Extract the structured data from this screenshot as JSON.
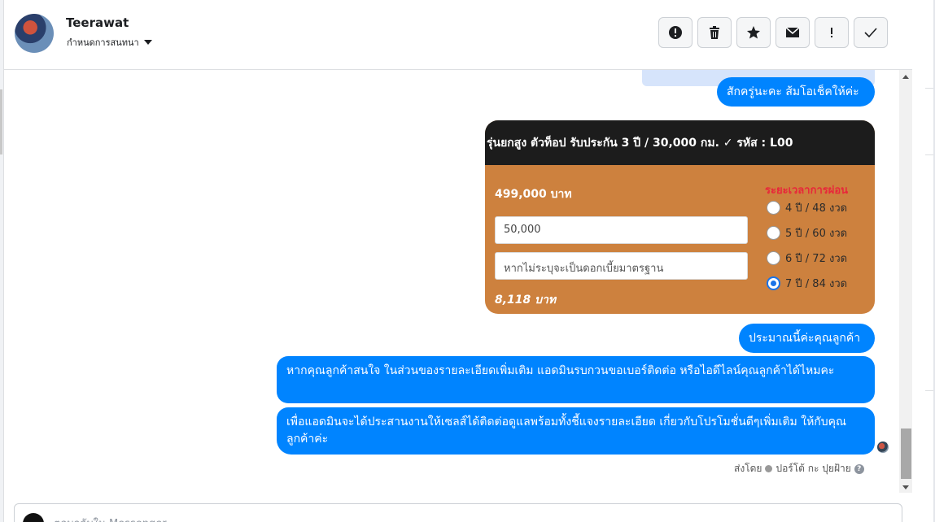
{
  "header": {
    "contact_name": "Teerawat",
    "assign_label": "กำหนดการสนทนา",
    "toolbar": [
      "spam-icon",
      "trash-icon",
      "star-icon",
      "envelope-icon",
      "exclamation-icon",
      "check-icon"
    ]
  },
  "messages": {
    "m1": "สักครู่นะคะ ส้มโอเช็คให้ค่ะ",
    "m2": "ประมาณนี้ค่ะคุณลูกค้า",
    "m3": "หากคุณลูกค้าสนใจ ในส่วนของรายละเอียดเพิ่มเติม แอดมินรบกวนขอเบอร์ติดต่อ หรือไอดีไลน์คุณลูกค้าได้ไหมคะ",
    "m4": "เพื่อแอดมินจะได้ประสานงานให้เซลส์ได้ติดต่อดูแลพร้อมทั้งชี้แจงรายละเอียด เกี่ยวกับโปรโมชั่นดีๆเพิ่มเติม ให้กับคุณลูกค้าค่ะ"
  },
  "card": {
    "headline": "รุ่นยกสูง ตัวท็อป รับประกัน 3 ปี / 30,000 กม. ✓ รหัส : L00",
    "price": "499,000 บาท",
    "down_payment": "50,000",
    "interest_placeholder": "หากไม่ระบุจะเป็นดอกเบี้ยมาตรฐาน",
    "monthly": "8,118 บาท",
    "plan_title": "ระยะเวลาการผ่อน",
    "options": [
      "4 ปี / 48 งวด",
      "5 ปี / 60 งวด",
      "6 ปี / 72 งวด",
      "7 ปี / 84 งวด"
    ],
    "selected_option": "7 ปี / 84 งวด"
  },
  "footer": {
    "sent_by_label": "ส่งโดย",
    "sent_by_name": "ปอร์โต้ กะ ปุยฝ้าย",
    "composer_placeholder": "ตอบกลับใน Messenger"
  },
  "colors": {
    "bubble": "#0084ff",
    "card_body": "#cd813e",
    "card_head": "#1c1c1c",
    "plan_title": "#e8273a"
  }
}
